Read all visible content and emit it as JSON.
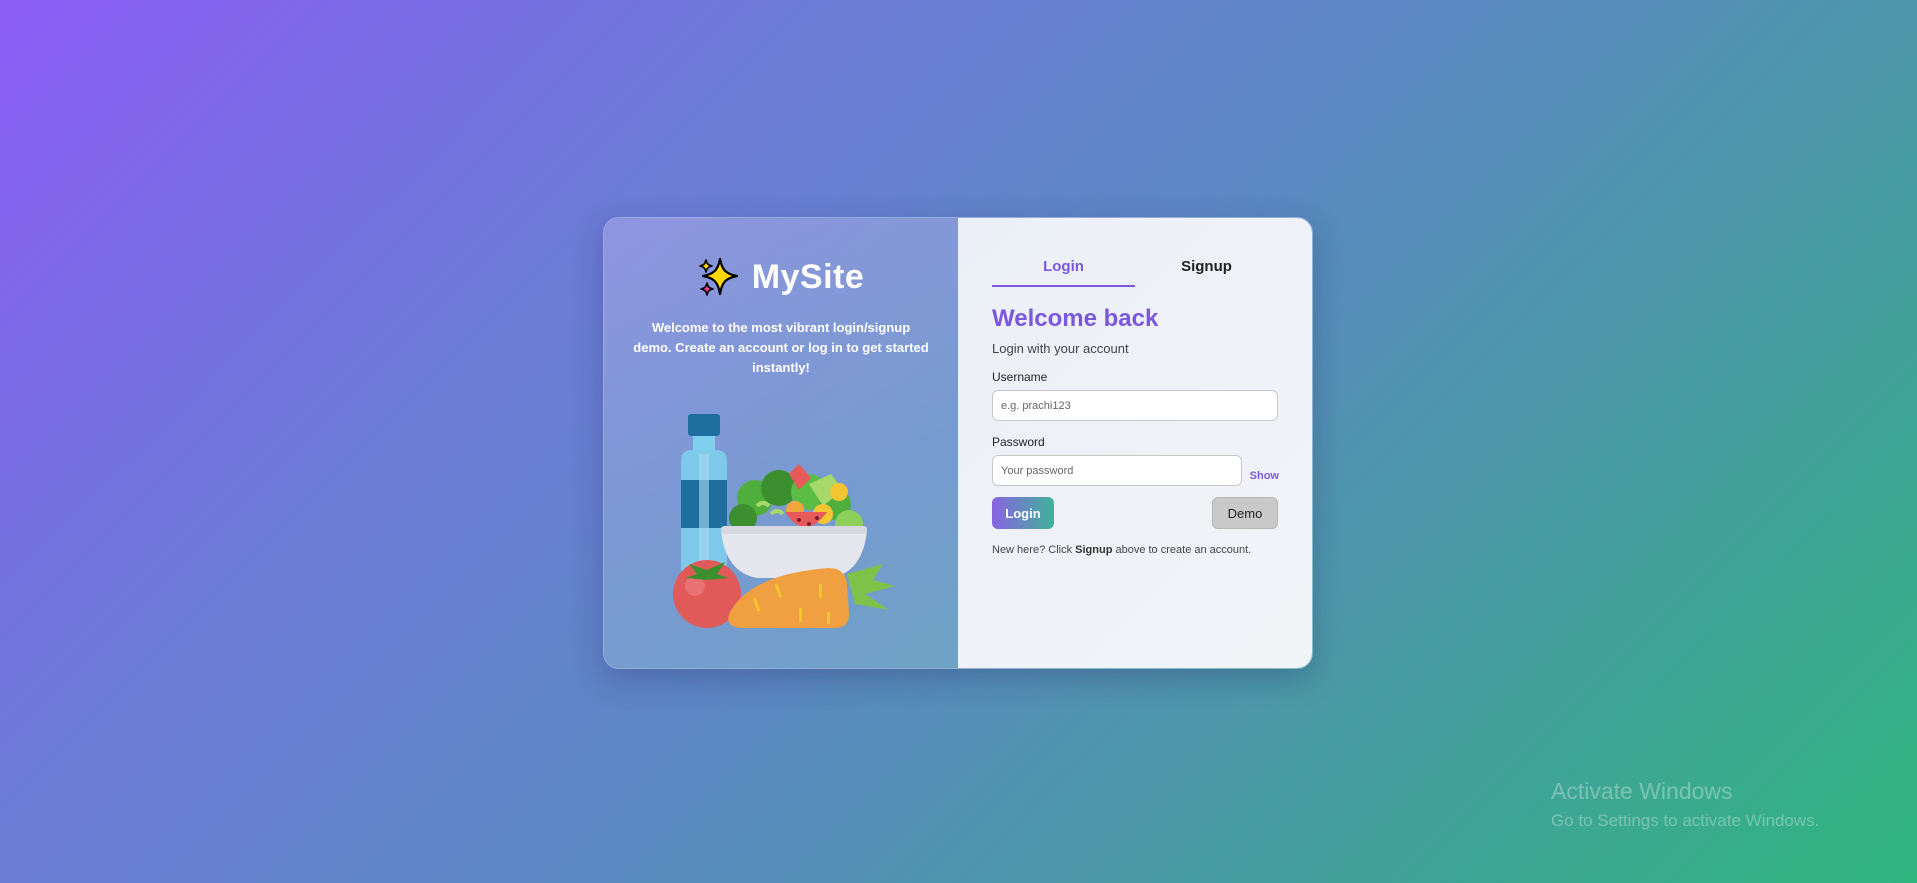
{
  "brand": {
    "title": "MySite",
    "tagline": "Welcome to the most vibrant login/signup demo. Create an account or log in to get started instantly!"
  },
  "tabs": [
    {
      "label": "Login",
      "active": true
    },
    {
      "label": "Signup",
      "active": false
    }
  ],
  "form": {
    "heading": "Welcome back",
    "subheading": "Login with your account",
    "username_label": "Username",
    "username_placeholder": "e.g. prachi123",
    "username_value": "",
    "password_label": "Password",
    "password_placeholder": "Your password",
    "password_value": "",
    "show_label": "Show",
    "login_button": "Login",
    "demo_button": "Demo",
    "hint_prefix": "New here? Click ",
    "hint_link": "Signup",
    "hint_suffix": " above to create an account."
  },
  "watermark": {
    "line1": "Activate Windows",
    "line2": "Go to Settings to activate Windows."
  },
  "icons": {
    "brand": "sparkles-icon",
    "illustration": "healthy-food-illustration"
  },
  "colors": {
    "accent": "#7b57e0",
    "accent_green": "#3fb29a",
    "bg_start": "#8b5cf6",
    "bg_end": "#2fb57e"
  }
}
